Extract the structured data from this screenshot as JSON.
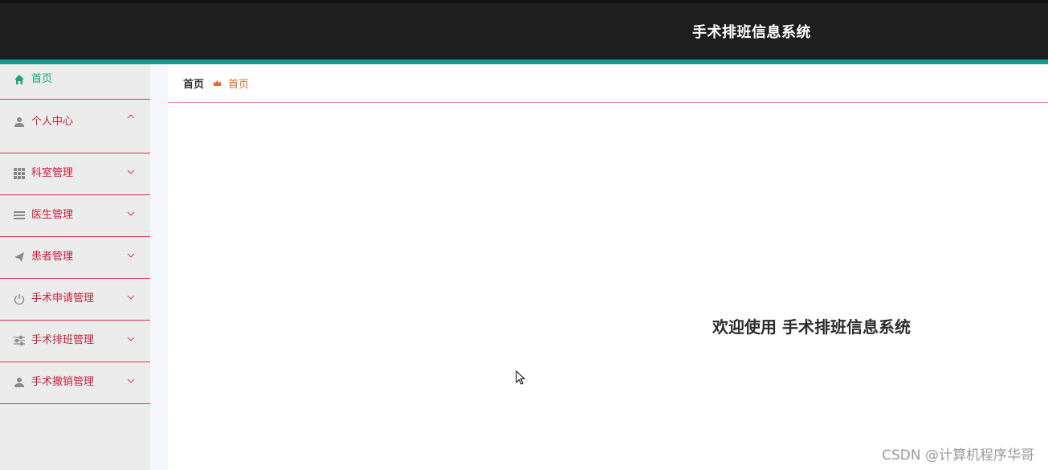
{
  "header": {
    "app_title": "手术排班信息系统"
  },
  "sidebar": {
    "items": [
      {
        "label": "首页",
        "icon": "home-icon",
        "active": true
      },
      {
        "label": "个人中心",
        "icon": "user-icon",
        "expanded": true
      },
      {
        "label": "科室管理",
        "icon": "grid-icon"
      },
      {
        "label": "医生管理",
        "icon": "list-icon"
      },
      {
        "label": "患者管理",
        "icon": "send-icon"
      },
      {
        "label": "手术申请管理",
        "icon": "power-icon"
      },
      {
        "label": "手术排班管理",
        "icon": "sliders-icon"
      },
      {
        "label": "手术撤销管理",
        "icon": "user-icon"
      }
    ]
  },
  "breadcrumb": {
    "root": "首页",
    "current": "首页"
  },
  "main": {
    "welcome": "欢迎使用 手术排班信息系统"
  },
  "watermark": "CSDN @计算机程序华哥",
  "colors": {
    "header_bg": "#1e1e1e",
    "accent": "#13998d",
    "menu_text": "#c8213a",
    "active_text": "#1aa179",
    "crumb_current": "#e3672b"
  }
}
